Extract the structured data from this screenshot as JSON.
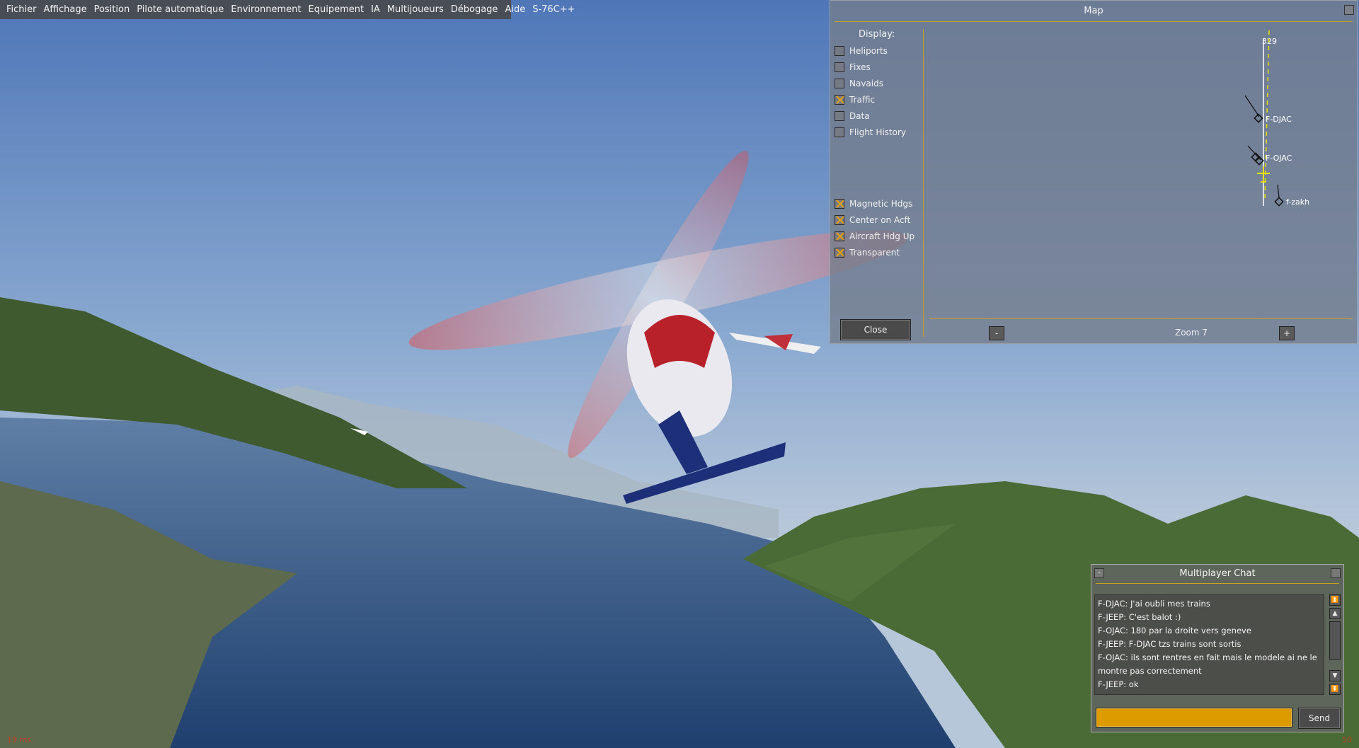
{
  "menubar": {
    "items": [
      "Fichier",
      "Affichage",
      "Position",
      "Pilote automatique",
      "Environnement",
      "Equipement",
      "IA",
      "Multijoueurs",
      "Débogage",
      "Aide",
      "S-76C++"
    ]
  },
  "map_window": {
    "title": "Map",
    "display_label": "Display:",
    "options": [
      {
        "label": "Heliports",
        "checked": false
      },
      {
        "label": "Fixes",
        "checked": false
      },
      {
        "label": "Navaids",
        "checked": false
      },
      {
        "label": "Traffic",
        "checked": true
      },
      {
        "label": "Data",
        "checked": false
      },
      {
        "label": "Flight History",
        "checked": false
      }
    ],
    "view_options": [
      {
        "label": "Magnetic Hdgs",
        "checked": true
      },
      {
        "label": "Center on Acft",
        "checked": true
      },
      {
        "label": "Aircraft Hdg Up",
        "checked": true
      },
      {
        "label": "Transparent",
        "checked": true
      }
    ],
    "close_label": "Close",
    "zoom_out_label": "-",
    "zoom_in_label": "+",
    "zoom_label": "Zoom 7",
    "heading_readout": "329",
    "traffic": [
      "F-DJAC",
      "F-OJAC",
      "f-zakh"
    ]
  },
  "chat_window": {
    "title": "Multiplayer Chat",
    "minimize_label": "-",
    "messages": [
      "F-DJAC: J'ai oubli mes trains",
      "F-JEEP: C'est balot :)",
      "F-OJAC: 180 par la droite vers geneve",
      "F-JEEP: F-DJAC tzs trains sont sortis",
      "F-OJAC: ils sont rentres en fait mais le modele ai ne le montre pas correctement",
      "F-JEEP: ok"
    ],
    "input_value": "",
    "send_label": "Send"
  },
  "status": {
    "frame_time": "19 ms",
    "fps": "50"
  },
  "colors": {
    "accent": "#c8a020",
    "input": "#dd9b00",
    "sky_top": "#4f78b8",
    "water": "#2f4f7a",
    "hills": "#3d5a2c"
  }
}
